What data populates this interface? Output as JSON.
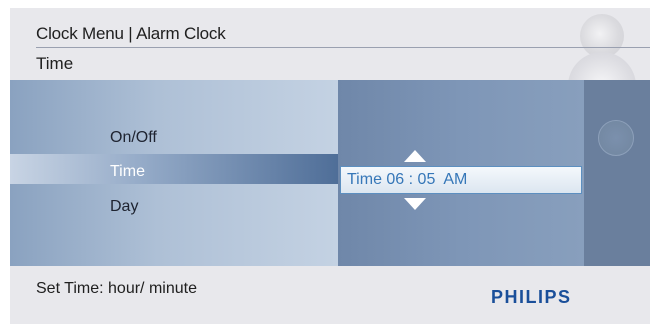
{
  "header": {
    "title": "Clock Menu | Alarm Clock",
    "subtitle": "Time"
  },
  "menu": {
    "items": [
      {
        "label": "On/Off",
        "selected": false
      },
      {
        "label": "Time",
        "selected": true
      },
      {
        "label": "Day",
        "selected": false
      }
    ]
  },
  "editor": {
    "value": "Time 06 : 05  AM",
    "up_icon": "arrow-up-icon",
    "down_icon": "arrow-down-icon"
  },
  "footer": {
    "hint": "Set Time: hour/ minute",
    "brand": "PHILIPS"
  },
  "colors": {
    "brand": "#1a4f9a",
    "panel": "#7f95b4",
    "highlight_text": "#3677b8"
  },
  "side_icons": [
    "settings-icon",
    "navigation-icon",
    "menu-icon"
  ]
}
